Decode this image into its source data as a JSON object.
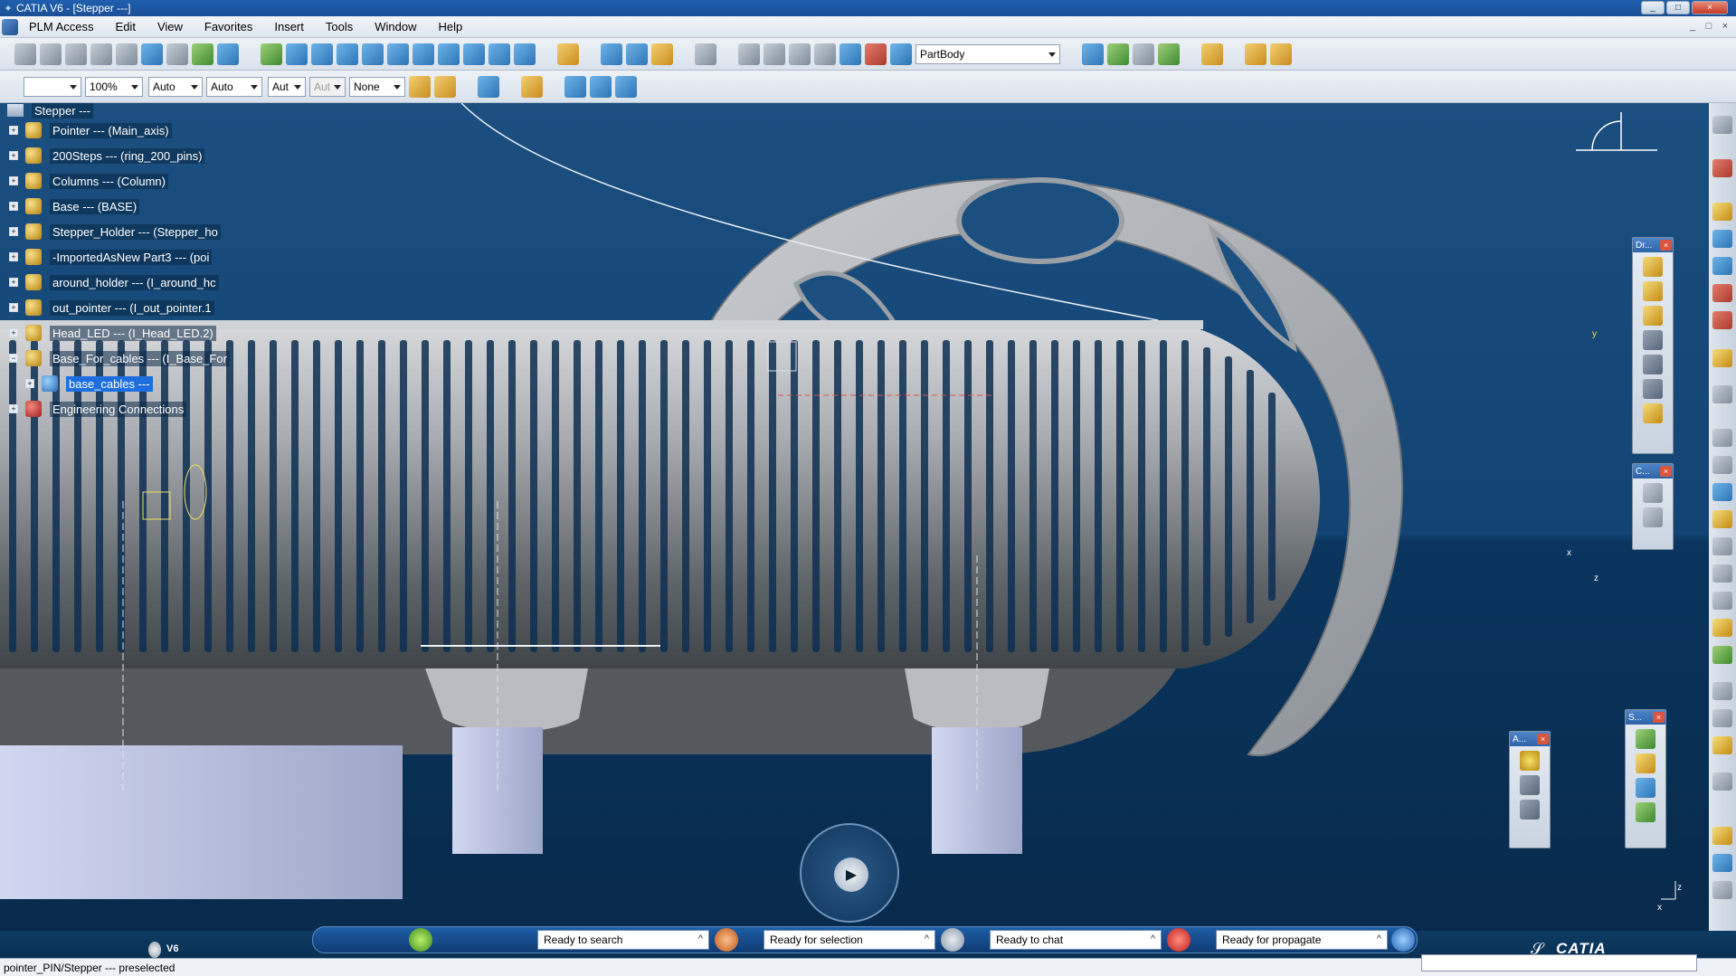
{
  "window": {
    "title": "CATIA V6 - [Stepper ---]",
    "controls": [
      "_",
      "□",
      "×"
    ]
  },
  "menu": {
    "items": [
      "PLM Access",
      "Edit",
      "View",
      "Favorites",
      "Insert",
      "Tools",
      "Window",
      "Help"
    ],
    "mdi_controls": [
      "_",
      "□",
      "×"
    ]
  },
  "toolbar1": {
    "current_body": "PartBody"
  },
  "toolbar2": {
    "zoom": "100%",
    "fill_1": "Auto",
    "fill_2": "Auto",
    "fill_3": "Aut",
    "fill_4": "Aut",
    "layer": "None"
  },
  "tree": {
    "root": "Stepper ---",
    "nodes": [
      {
        "label": "Pointer --- (Main_axis)",
        "sign": "+"
      },
      {
        "label": "200Steps --- (ring_200_pins)",
        "sign": "+"
      },
      {
        "label": "Columns --- (Column)",
        "sign": "+"
      },
      {
        "label": "Base --- (BASE)",
        "sign": "+"
      },
      {
        "label": "Stepper_Holder --- (Stepper_ho",
        "sign": "+"
      },
      {
        "label": "-ImportedAsNew Part3 --- (poi",
        "sign": "+"
      },
      {
        "label": "around_holder --- (I_around_hc",
        "sign": "+"
      },
      {
        "label": "out_pointer --- (I_out_pointer.1",
        "sign": "+"
      },
      {
        "label": "Head_LED --- (I_Head_LED.2)",
        "sign": "+"
      },
      {
        "label": "Base_For_cables --- (I_Base_For",
        "sign": "−"
      },
      {
        "label": "base_cables ---",
        "sign": "+"
      },
      {
        "label": "Engineering Connections",
        "sign": "+"
      }
    ]
  },
  "palettes": {
    "dr": "Dr...",
    "c": "C...",
    "a": "A...",
    "s": "S..."
  },
  "axes": {
    "x": "x",
    "y": "y",
    "z": "z"
  },
  "status": {
    "v6_label": "V6",
    "search": "Ready to search",
    "selection": "Ready for selection",
    "chat": "Ready to chat",
    "propagate": "Ready for propagate",
    "caret": "^",
    "brand": "CATIA",
    "message": "pointer_PIN/Stepper --- preselected"
  }
}
